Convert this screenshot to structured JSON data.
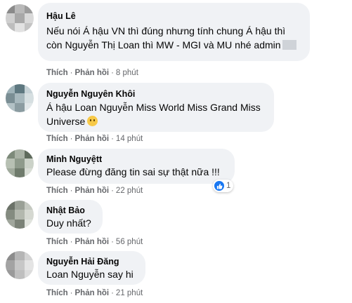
{
  "comments": [
    {
      "author": "Hậu Lê",
      "lines": [
        "Nếu nói Á hậu VN thì đúng nhưng tính chung Á hậu thì",
        "còn Nguyễn Thị Loan thì MW - MGI và MU nhé admin"
      ],
      "like_label": "Thích",
      "reply_label": "Phản hồi",
      "time": "8 phút",
      "avatar_colors": [
        "#8a8a8a",
        "#b9b9b9",
        "#9c9c9c",
        "#cfcfcf",
        "#a8a8a8",
        "#d9d9d9",
        "#bdbdbd",
        "#e2e2e2",
        "#c4c4c4"
      ]
    },
    {
      "author": "Nguyễn Nguyên Khôi",
      "lines": [
        "Á hậu Loan Nguyễn Miss World Miss Grand Miss",
        "Universe"
      ],
      "emoji": "slightly-frowning-face",
      "like_label": "Thích",
      "reply_label": "Phản hồi",
      "time": "14 phút",
      "avatar_colors": [
        "#9fb3b9",
        "#5e7880",
        "#c6d2d6",
        "#7a8e94",
        "#a7b8bd",
        "#d6dfe1",
        "#b2c1c5",
        "#8b9ca1",
        "#e1e7e9"
      ]
    },
    {
      "author": "Minh Nguyệtt",
      "lines": [
        "Please đừng đăng tin sai sự thật nữa !!!"
      ],
      "like_label": "Thích",
      "reply_label": "Phản hồi",
      "time": "22 phút",
      "reaction": {
        "icon": "like-icon",
        "count": "1"
      },
      "avatar_colors": [
        "#7d8a7a",
        "#a9b2a5",
        "#5f6b5c",
        "#b7c0b3",
        "#8e9a8b",
        "#cbd2c8",
        "#a0aa9c",
        "#6f7b6c",
        "#d8ddd5"
      ]
    },
    {
      "author": "Nhật Bảo",
      "lines": [
        "Duy nhất?"
      ],
      "like_label": "Thích",
      "reply_label": "Phản hồi",
      "time": "56 phút",
      "avatar_colors": [
        "#6b7268",
        "#9aa096",
        "#c5c9c1",
        "#848b80",
        "#b3b8ae",
        "#d5d8d1",
        "#a0a69c",
        "#7b8277",
        "#e0e3dd"
      ]
    },
    {
      "author": "Nguyễn Hải Đăng",
      "lines": [
        "Loan Nguyễn say hi"
      ],
      "like_label": "Thích",
      "reply_label": "Phản hồi",
      "time": "21 phút",
      "avatar_colors": [
        "#8c8c8c",
        "#b5b5b5",
        "#d3d3d3",
        "#a3a3a3",
        "#c7c7c7",
        "#e4e4e4",
        "#9a9a9a",
        "#bfbfbf",
        "#dcdcdc"
      ]
    }
  ],
  "colors": {
    "bubble": "#f0f2f5",
    "meta": "#65676b",
    "like": "#1877f2"
  }
}
